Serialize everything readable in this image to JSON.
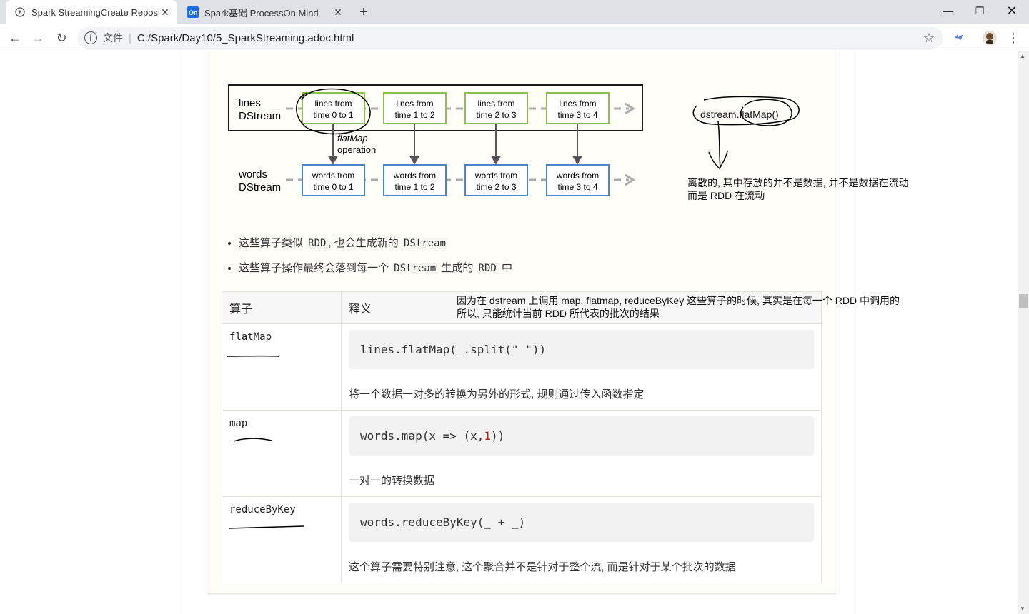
{
  "tabs": [
    {
      "title": "Spark StreamingCreate Reposi",
      "active": true
    },
    {
      "title": "Spark基础 ProcessOn Mind",
      "active": false
    }
  ],
  "address": {
    "scheme": "文件",
    "url": "C:/Spark/Day10/5_SparkStreaming.adoc.html"
  },
  "diagram": {
    "row1_label_1": "lines",
    "row1_label_2": "DStream",
    "row2_label_1": "words",
    "row2_label_2": "DStream",
    "lines_boxes": [
      [
        "lines from",
        "time 0 to 1"
      ],
      [
        "lines from",
        "time 1 to 2"
      ],
      [
        "lines from",
        "time 2 to 3"
      ],
      [
        "lines from",
        "time 3 to 4"
      ]
    ],
    "words_boxes": [
      [
        "words from",
        "time 0 to 1"
      ],
      [
        "words from",
        "time 1 to 2"
      ],
      [
        "words from",
        "time 2 to 3"
      ],
      [
        "words from",
        "time 3 to 4"
      ]
    ],
    "op_name": "flatMap",
    "op_word": "operation"
  },
  "annotations": {
    "dstream_call": "dstream.flatMap()",
    "note1_line1": "离散的, 其中存放的并不是数据, 并不是数据在流动",
    "note1_line2": "而是 RDD 在流动",
    "note2_line1": "因为在 dstream 上调用 map, flatmap, reduceByKey 这些算子的时候, 其实是在每一个 RDD 中调用的",
    "note2_line2": "所以, 只能统计当前 RDD 所代表的批次的结果"
  },
  "bullets": [
    {
      "pre": "这些算子类似 ",
      "code1": "RDD",
      "mid": ", 也会生成新的 ",
      "code2": "DStream",
      "post": ""
    },
    {
      "pre": "这些算子操作最终会落到每一个 ",
      "code1": "DStream",
      "mid": " 生成的 ",
      "code2": "RDD",
      "post": " 中"
    }
  ],
  "table": {
    "headers": [
      "算子",
      "释义"
    ],
    "rows": [
      {
        "name": "flatMap",
        "code": "lines.flatMap(_.split(\" \"))",
        "desc": "将一个数据一对多的转换为另外的形式, 规则通过传入函数指定"
      },
      {
        "name": "map",
        "code_pre": "words.map(x => (x, ",
        "code_num": "1",
        "code_post": "))",
        "desc": "一对一的转换数据"
      },
      {
        "name": "reduceByKey",
        "code": "words.reduceByKey(_ + _)",
        "desc": "这个算子需要特别注意, 这个聚合并不是针对于整个流, 而是针对于某个批次的数据"
      }
    ]
  },
  "icons": [
    "globe-icon",
    "processon-icon",
    "close-icon",
    "plus-icon",
    "back-icon",
    "forward-icon",
    "reload-icon",
    "info-icon",
    "star-icon",
    "extension-icon",
    "avatar",
    "menu-icon",
    "minimize-icon",
    "maximize-icon"
  ]
}
